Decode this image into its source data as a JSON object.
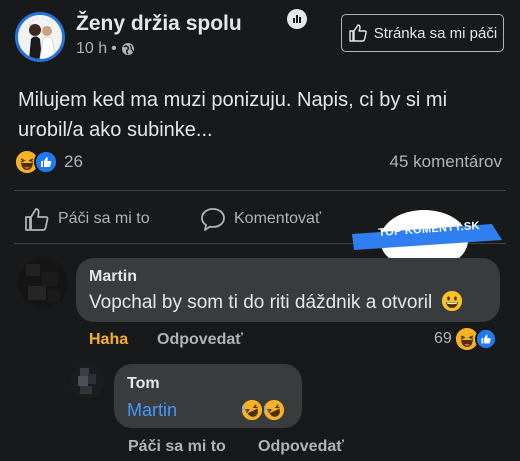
{
  "header": {
    "page_name": "Ženy držia spolu",
    "time": "10 h",
    "separator": "•",
    "like_page_label": "Stránka sa mi páči"
  },
  "post": {
    "text": "Milujem ked ma muzi ponizuju. Napis, ci by si mi urobil/a ako subinke...",
    "reaction_count": "26",
    "comment_count": "45 komentárov"
  },
  "actions": {
    "like": "Páči sa mi to",
    "comment": "Komentovať"
  },
  "watermark": {
    "text": "TOP KOMENTY.SK"
  },
  "comments": [
    {
      "author": "Martin",
      "text": "Vopchal by som ti do riti dáždnik a otvoril",
      "reaction_label": "Haha",
      "reply_label": "Odpovedať",
      "reaction_count": "69"
    }
  ],
  "reply": {
    "author": "Tom",
    "mention": "Martin",
    "like_label": "Páči sa mi to",
    "reply_label": "Odpovedať"
  },
  "colors": {
    "background": "#18191a",
    "bubble": "#3a3b3c",
    "accent": "#2374e1",
    "haha": "#f7b125",
    "mention": "#4599ff"
  }
}
